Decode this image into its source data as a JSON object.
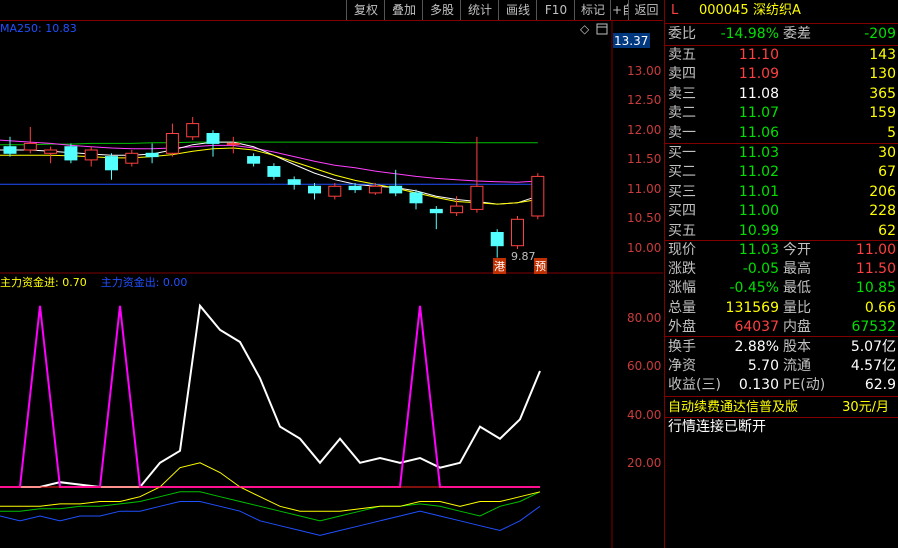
{
  "toolbar": {
    "buttons": [
      "复权",
      "叠加",
      "多股",
      "统计",
      "画线",
      "F10",
      "标记",
      "+自选",
      "返回"
    ]
  },
  "stock": {
    "marker": "L",
    "code": "000045",
    "name": "深纺织A"
  },
  "ma_label": "MA250: 10.83",
  "indicator_label": {
    "jin": "主力资金进: 0.70",
    "chu": "主力资金出: 0.00"
  },
  "price_axis": {
    "current_box": "13.37",
    "ticks": [
      "13.00",
      "12.50",
      "12.00",
      "11.50",
      "11.00",
      "10.50",
      "10.00"
    ]
  },
  "indicator_axis": {
    "ticks": [
      "80.00",
      "60.00",
      "40.00",
      "20.00"
    ]
  },
  "annotations": {
    "low_price": "9.87",
    "tag_gang": "港",
    "tag_yu": "预"
  },
  "order_book": {
    "wei_bi": {
      "label": "委比",
      "value": "-14.98%"
    },
    "wei_cha": {
      "label": "委差",
      "value": "-209"
    },
    "sell": [
      {
        "label": "卖五",
        "price": "11.10",
        "vol": "143"
      },
      {
        "label": "卖四",
        "price": "11.09",
        "vol": "130"
      },
      {
        "label": "卖三",
        "price": "11.08",
        "vol": "365"
      },
      {
        "label": "卖二",
        "price": "11.07",
        "vol": "159"
      },
      {
        "label": "卖一",
        "price": "11.06",
        "vol": "5"
      }
    ],
    "buy": [
      {
        "label": "买一",
        "price": "11.03",
        "vol": "30"
      },
      {
        "label": "买二",
        "price": "11.02",
        "vol": "67"
      },
      {
        "label": "买三",
        "price": "11.01",
        "vol": "206"
      },
      {
        "label": "买四",
        "price": "11.00",
        "vol": "228"
      },
      {
        "label": "买五",
        "price": "10.99",
        "vol": "62"
      }
    ]
  },
  "quote": [
    {
      "l1": "现价",
      "v1": "11.03",
      "l2": "今开",
      "v2": "11.00"
    },
    {
      "l1": "涨跌",
      "v1": "-0.05",
      "l2": "最高",
      "v2": "11.50"
    },
    {
      "l1": "涨幅",
      "v1": "-0.45%",
      "l2": "最低",
      "v2": "10.85"
    },
    {
      "l1": "总量",
      "v1": "131569",
      "l2": "量比",
      "v2": "0.66"
    },
    {
      "l1": "外盘",
      "v1": "64037",
      "l2": "内盘",
      "v2": "67532"
    }
  ],
  "finance": [
    {
      "l1": "换手",
      "v1": "2.88%",
      "l2": "股本",
      "v2": "5.07亿"
    },
    {
      "l1": "净资",
      "v1": "5.70",
      "l2": "流通",
      "v2": "4.57亿"
    },
    {
      "l1": "收益(三)",
      "v1": "0.130",
      "l2": "PE(动)",
      "v2": "62.9"
    }
  ],
  "promo": {
    "text": "自动续费通达信普及版",
    "price": "30元/月"
  },
  "status": "行情连接已断开",
  "chart_data": {
    "type": "candlestick",
    "price_axis_ticks": [
      13.0,
      12.5,
      12.0,
      11.5,
      11.0,
      10.5,
      10.0
    ],
    "price_axis_current": 13.37,
    "low_label": 9.87,
    "candles": [
      {
        "o": 11.55,
        "c": 11.45,
        "h": 11.7,
        "l": 11.4
      },
      {
        "o": 11.5,
        "c": 11.6,
        "h": 11.85,
        "l": 11.45
      },
      {
        "o": 11.45,
        "c": 11.5,
        "h": 11.55,
        "l": 11.3
      },
      {
        "o": 11.55,
        "c": 11.35,
        "h": 11.6,
        "l": 11.3
      },
      {
        "o": 11.35,
        "c": 11.5,
        "h": 11.55,
        "l": 11.25
      },
      {
        "o": 11.4,
        "c": 11.2,
        "h": 11.45,
        "l": 11.05
      },
      {
        "o": 11.3,
        "c": 11.45,
        "h": 11.5,
        "l": 11.25
      },
      {
        "o": 11.45,
        "c": 11.4,
        "h": 11.6,
        "l": 11.3
      },
      {
        "o": 11.45,
        "c": 11.75,
        "h": 11.9,
        "l": 11.4
      },
      {
        "o": 11.7,
        "c": 11.9,
        "h": 12.0,
        "l": 11.65
      },
      {
        "o": 11.75,
        "c": 11.6,
        "h": 11.8,
        "l": 11.4
      },
      {
        "o": 11.6,
        "c": 11.6,
        "h": 11.7,
        "l": 11.45
      },
      {
        "o": 11.4,
        "c": 11.3,
        "h": 11.45,
        "l": 11.25
      },
      {
        "o": 11.25,
        "c": 11.1,
        "h": 11.3,
        "l": 11.05
      },
      {
        "o": 11.05,
        "c": 10.98,
        "h": 11.1,
        "l": 10.9
      },
      {
        "o": 10.95,
        "c": 10.85,
        "h": 11.0,
        "l": 10.75
      },
      {
        "o": 10.8,
        "c": 10.95,
        "h": 11.0,
        "l": 10.75
      },
      {
        "o": 10.95,
        "c": 10.9,
        "h": 11.0,
        "l": 10.85
      },
      {
        "o": 10.85,
        "c": 10.95,
        "h": 11.0,
        "l": 10.82
      },
      {
        "o": 10.95,
        "c": 10.85,
        "h": 11.2,
        "l": 10.8
      },
      {
        "o": 10.85,
        "c": 10.7,
        "h": 10.9,
        "l": 10.6
      },
      {
        "o": 10.6,
        "c": 10.55,
        "h": 10.65,
        "l": 10.3
      },
      {
        "o": 10.55,
        "c": 10.65,
        "h": 10.8,
        "l": 10.5
      },
      {
        "o": 10.6,
        "c": 10.95,
        "h": 11.7,
        "l": 10.55
      },
      {
        "o": 10.25,
        "c": 10.05,
        "h": 10.3,
        "l": 9.87
      },
      {
        "o": 10.05,
        "c": 10.45,
        "h": 10.5,
        "l": 10.0
      },
      {
        "o": 10.5,
        "c": 11.1,
        "h": 11.15,
        "l": 10.45
      }
    ],
    "ma_lines": [
      {
        "color": "#00c000",
        "values": [
          11.58,
          11.58,
          11.59,
          11.59,
          11.6,
          11.6,
          11.6,
          11.61,
          11.61,
          11.62,
          11.62,
          11.62,
          11.62,
          11.62,
          11.62,
          11.62,
          11.62,
          11.62,
          11.62,
          11.62,
          11.62,
          11.62,
          11.61,
          11.61,
          11.61,
          11.61,
          11.61
        ]
      },
      {
        "color": "#ff40ff",
        "values": [
          11.65,
          11.62,
          11.6,
          11.57,
          11.55,
          11.53,
          11.52,
          11.52,
          11.53,
          11.55,
          11.57,
          11.57,
          11.53,
          11.47,
          11.4,
          11.33,
          11.27,
          11.23,
          11.18,
          11.14,
          11.1,
          11.07,
          11.05,
          11.03,
          11.02,
          11.01,
          11.03
        ]
      },
      {
        "color": "#ffffff",
        "values": [
          11.5,
          11.5,
          11.48,
          11.46,
          11.44,
          11.42,
          11.42,
          11.44,
          11.5,
          11.58,
          11.62,
          11.62,
          11.55,
          11.42,
          11.28,
          11.15,
          11.05,
          10.98,
          10.95,
          10.93,
          10.88,
          10.8,
          10.75,
          10.72,
          10.68,
          10.7,
          10.8
        ]
      },
      {
        "color": "#ffff00",
        "values": [
          11.42,
          11.42,
          11.42,
          11.41,
          11.4,
          11.38,
          11.38,
          11.4,
          11.43,
          11.48,
          11.52,
          11.53,
          11.5,
          11.42,
          11.32,
          11.22,
          11.12,
          11.04,
          10.98,
          10.92,
          10.85,
          10.78,
          10.72,
          10.7,
          10.68,
          10.7,
          10.75
        ]
      },
      {
        "color": "#2050ff",
        "values": [
          10.98,
          10.98,
          10.98,
          10.98,
          10.98,
          10.98,
          10.98,
          10.98,
          10.98,
          10.98,
          10.98,
          10.98,
          10.98,
          10.98,
          10.98,
          10.98,
          10.98,
          10.98,
          10.98,
          10.98,
          10.98,
          10.98,
          10.98,
          10.98,
          10.98,
          10.98,
          10.98
        ]
      }
    ],
    "indicator_axis_ticks": [
      80.0,
      60.0,
      40.0,
      20.0
    ],
    "indicator_series": [
      {
        "name": "主力资金进",
        "color": "#ffffff",
        "values": [
          0,
          0,
          0,
          2,
          1,
          0,
          0,
          0,
          10,
          15,
          75,
          65,
          60,
          45,
          25,
          20,
          10,
          20,
          10,
          12,
          10,
          12,
          8,
          10,
          25,
          20,
          28,
          48
        ]
      },
      {
        "name": "spike",
        "color": "#ff00ff",
        "values": [
          0,
          0,
          75,
          0,
          0,
          0,
          75,
          0,
          0,
          0,
          0,
          0,
          0,
          0,
          0,
          0,
          0,
          0,
          0,
          0,
          0,
          75,
          0,
          0,
          0,
          0,
          0,
          0
        ]
      },
      {
        "name": "主力资金出",
        "color": "#2050ff",
        "values": [
          -12,
          -14,
          -12,
          -14,
          -12,
          -12,
          -10,
          -10,
          -8,
          -6,
          -6,
          -8,
          -10,
          -14,
          -16,
          -18,
          -20,
          -18,
          -16,
          -14,
          -12,
          -10,
          -12,
          -14,
          -16,
          -18,
          -14,
          -8
        ]
      },
      {
        "name": "green",
        "color": "#00c000",
        "values": [
          -10,
          -10,
          -9,
          -9,
          -8,
          -8,
          -7,
          -6,
          -4,
          -2,
          -2,
          -4,
          -6,
          -8,
          -10,
          -12,
          -14,
          -12,
          -10,
          -8,
          -8,
          -7,
          -8,
          -10,
          -12,
          -8,
          -6,
          -2
        ]
      },
      {
        "name": "yellow",
        "color": "#ffff00",
        "values": [
          -8,
          -8,
          -8,
          -7,
          -7,
          -6,
          -6,
          -4,
          0,
          8,
          10,
          6,
          0,
          -4,
          -8,
          -10,
          -10,
          -10,
          -9,
          -8,
          -8,
          -6,
          -6,
          -8,
          -6,
          -6,
          -4,
          -2
        ]
      },
      {
        "name": "red-base",
        "color": "#ff2020",
        "values": [
          0,
          0,
          0,
          0,
          0,
          0,
          0,
          0,
          0,
          0,
          0,
          0,
          0,
          0,
          0,
          0,
          0,
          0,
          0,
          0,
          0,
          0,
          0,
          0,
          0,
          0,
          0,
          0
        ]
      }
    ]
  }
}
